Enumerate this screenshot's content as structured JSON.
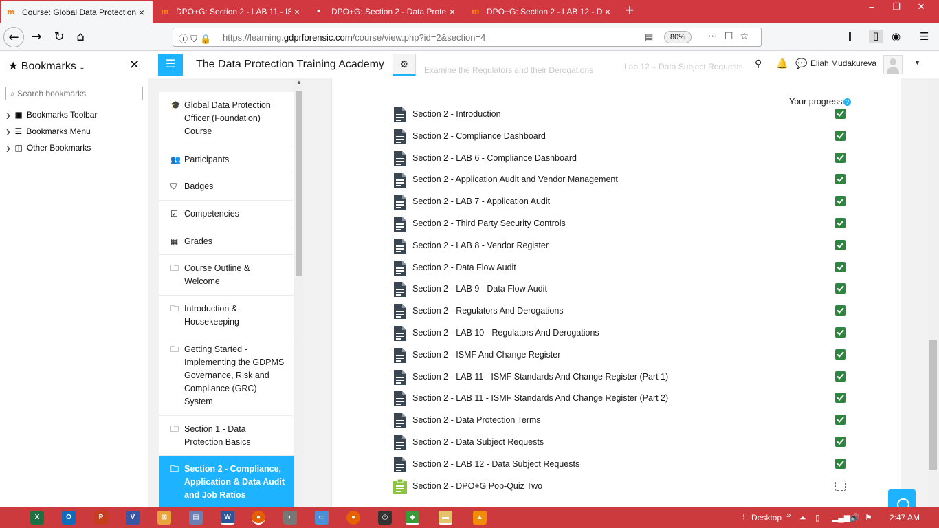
{
  "browser": {
    "tabs": [
      {
        "title": "Course: Global Data Protection",
        "active": true
      },
      {
        "title": "DPO+G: Section 2 - LAB 11 - IS",
        "active": false
      },
      {
        "title": "DPO+G: Section 2 - Data Prote",
        "active": false
      },
      {
        "title": "DPO+G: Section 2 - LAB 12 - D",
        "active": false
      }
    ],
    "url_prefix": "https://learning.",
    "url_domain": "gdprforensic.com",
    "url_path": "/course/view.php?id=2&section=4",
    "zoom": "80%"
  },
  "bookmarks": {
    "title": "Bookmarks",
    "search_placeholder": "Search bookmarks",
    "items": [
      "Bookmarks Toolbar",
      "Bookmarks Menu",
      "Other Bookmarks"
    ]
  },
  "site": {
    "name": "The Data Protection Training Academy",
    "ghost_left": "Examine the Regulators and their Derogations",
    "ghost_right": "Lab 12 – Data Subject Requests",
    "user_name": "Eliah Mudakureva"
  },
  "drawer": {
    "items": [
      {
        "label": "Global Data Protection Officer (Foundation) Course",
        "icon": "graduation-cap-icon"
      },
      {
        "label": "Participants",
        "icon": "users-icon"
      },
      {
        "label": "Badges",
        "icon": "shield-icon"
      },
      {
        "label": "Competencies",
        "icon": "checkbox-icon"
      },
      {
        "label": "Grades",
        "icon": "table-icon"
      },
      {
        "label": "Course Outline & Welcome",
        "icon": "folder-icon"
      },
      {
        "label": "Introduction & Housekeeping",
        "icon": "folder-icon"
      },
      {
        "label": "Getting Started - Implementing the GDPMS Governance, Risk and Compliance (GRC) System",
        "icon": "folder-icon"
      },
      {
        "label": "Section 1 - Data Protection Basics",
        "icon": "folder-icon"
      },
      {
        "label": "Section 2 - Compliance, Application & Data Audit and Job Ratios",
        "icon": "folder-icon"
      }
    ]
  },
  "main": {
    "progress_label": "Your progress",
    "activities": [
      {
        "label": "Section 2 - Introduction",
        "type": "page",
        "done": true
      },
      {
        "label": "Section 2 - Compliance Dashboard",
        "type": "page",
        "done": true
      },
      {
        "label": "Section 2 - LAB 6 - Compliance Dashboard",
        "type": "page",
        "done": true
      },
      {
        "label": "Section 2 - Application Audit and Vendor Management",
        "type": "page",
        "done": true
      },
      {
        "label": "Section 2 - LAB 7 - Application Audit",
        "type": "page",
        "done": true
      },
      {
        "label": "Section 2 - Third Party Security Controls",
        "type": "page",
        "done": true
      },
      {
        "label": "Section 2 - LAB 8 - Vendor Register",
        "type": "page",
        "done": true
      },
      {
        "label": "Section 2 - Data Flow Audit",
        "type": "page",
        "done": true
      },
      {
        "label": "Section 2 - LAB 9 - Data Flow Audit",
        "type": "page",
        "done": true
      },
      {
        "label": "Section 2 - Regulators And Derogations",
        "type": "page",
        "done": true
      },
      {
        "label": "Section 2 - LAB 10 - Regulators And Derogations",
        "type": "page",
        "done": true
      },
      {
        "label": "Section 2 - ISMF And Change Register",
        "type": "page",
        "done": true
      },
      {
        "label": "Section 2 - LAB 11 - ISMF Standards And Change Register (Part 1)",
        "type": "page",
        "done": true
      },
      {
        "label": "Section 2 - LAB 11 - ISMF Standards And Change Register (Part 2)",
        "type": "page",
        "done": true
      },
      {
        "label": "Section 2 - Data Protection Terms",
        "type": "page",
        "done": true
      },
      {
        "label": "Section 2 - Data Subject Requests",
        "type": "page",
        "done": true
      },
      {
        "label": "Section 2 - LAB 12 - Data Subject Requests",
        "type": "page",
        "done": true
      },
      {
        "label": "Section 2 - DPO+G Pop-Quiz Two",
        "type": "quiz",
        "done": false
      }
    ]
  },
  "taskbar": {
    "desktop_label": "Desktop",
    "clock": "2:47 AM"
  },
  "colors": {
    "tabstrip": "#d2383f",
    "accent": "#1eb3ff",
    "complete": "#2e8540",
    "quiz_icon": "#8bc53f",
    "taskbar": "#cc3a3e"
  }
}
